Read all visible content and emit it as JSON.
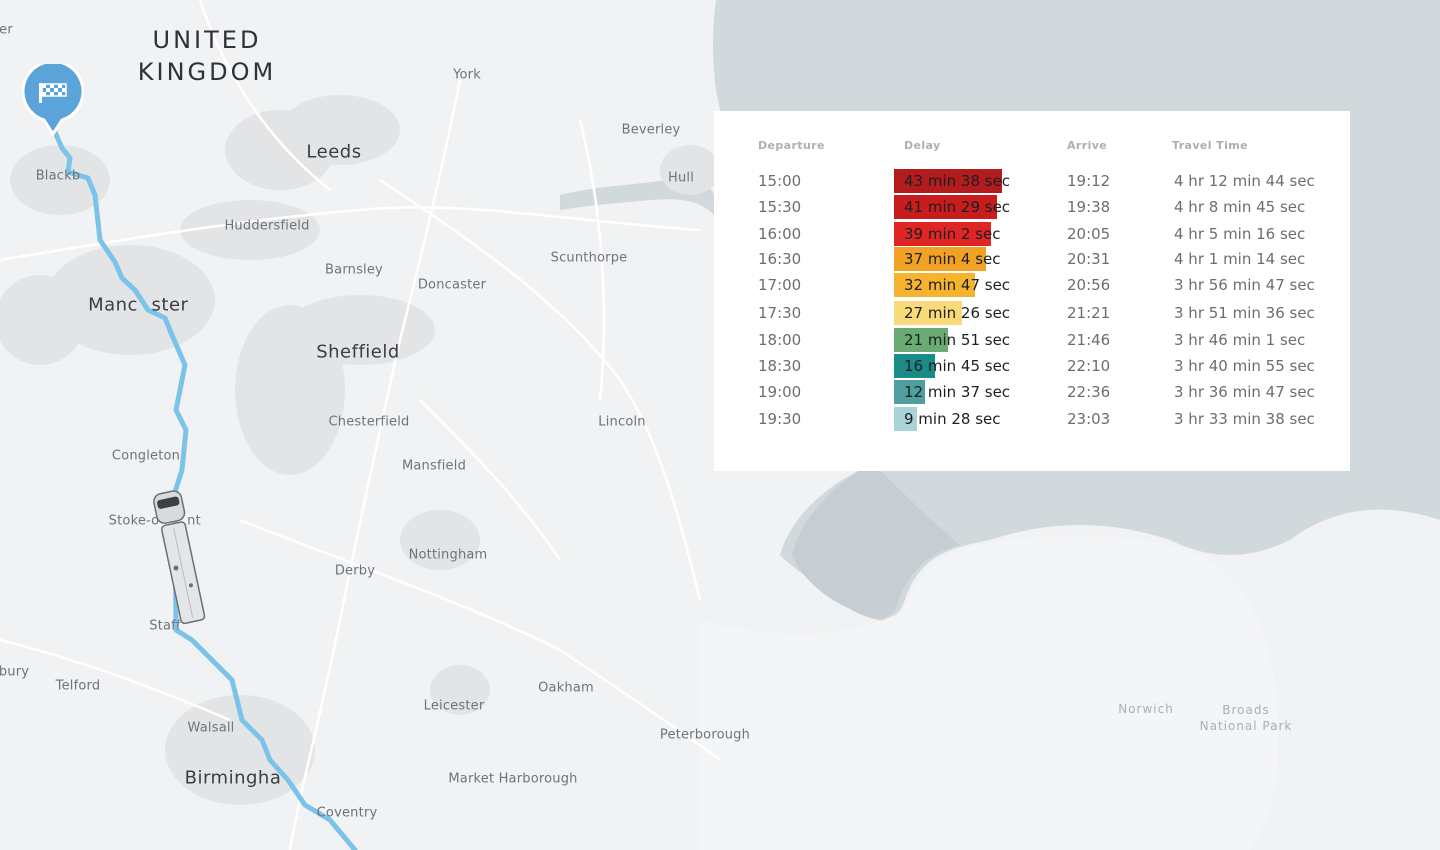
{
  "map": {
    "country_line1": "UNITED",
    "country_line2": "KINGDOM",
    "places": {
      "york": "York",
      "leeds": "Leeds",
      "beverley": "Beverley",
      "hull": "Hull",
      "blackburn_partial": "Blackb",
      "huddersfield": "Huddersfield",
      "barnsley": "Barnsley",
      "doncaster": "Doncaster",
      "scunthorpe": "Scunthorpe",
      "manchester_left": "Manc",
      "manchester_right": "ster",
      "sheffield": "Sheffield",
      "chesterfield": "Chesterfield",
      "lincoln": "Lincoln",
      "congleton": "Congleton",
      "mansfield": "Mansfield",
      "stoke_left": "Stoke-o",
      "stoke_right": "nt",
      "nottingham": "Nottingham",
      "derby": "Derby",
      "stafford_partial": "Staff",
      "bury_partial": "bury",
      "telford": "Telford",
      "oakham": "Oakham",
      "leicester": "Leicester",
      "walsall": "Walsall",
      "peterborough": "Peterborough",
      "birmingham": "Birmingha",
      "market_harborough": "Market Harborough",
      "coventry": "Coventry",
      "norwich": "Norwich",
      "broads_line1": "Broads",
      "broads_line2": "National Park",
      "edge_partial": "er"
    },
    "route_color": "#7cc3ea",
    "destination_icon": "checkered-flag-icon",
    "vehicle_icon": "truck-icon"
  },
  "table": {
    "headers": {
      "departure": "Departure",
      "delay": "Delay",
      "arrive": "Arrive",
      "travel_time": "Travel Time"
    },
    "rows": [
      {
        "departure": "15:00",
        "delay": "43 min 38 sec",
        "delay_minutes": 43.63,
        "color": "#b31c1c",
        "arrive": "19:12",
        "travel": "4 hr 12 min 44 sec"
      },
      {
        "departure": "15:30",
        "delay": "41 min 29 sec",
        "delay_minutes": 41.48,
        "color": "#c91d1d",
        "arrive": "19:38",
        "travel": "4 hr 8 min 45 sec"
      },
      {
        "departure": "16:00",
        "delay": "39 min 2 sec",
        "delay_minutes": 39.03,
        "color": "#e02525",
        "arrive": "20:05",
        "travel": "4 hr 5 min 16 sec"
      },
      {
        "departure": "16:30",
        "delay": "37 min 4 sec",
        "delay_minutes": 37.07,
        "color": "#f1a224",
        "arrive": "20:31",
        "travel": "4 hr 1 min 14 sec"
      },
      {
        "departure": "17:00",
        "delay": "32 min 47 sec",
        "delay_minutes": 32.78,
        "color": "#f6b32e",
        "arrive": "20:56",
        "travel": "3 hr 56 min 47 sec"
      },
      {
        "departure": "17:30",
        "delay": "27 min 26 sec",
        "delay_minutes": 27.43,
        "color": "#f9da78",
        "arrive": "21:21",
        "travel": "3 hr 51 min 36 sec"
      },
      {
        "departure": "18:00",
        "delay": "21 min 51 sec",
        "delay_minutes": 21.85,
        "color": "#69ab72",
        "arrive": "21:46",
        "travel": "3 hr 46 min 1 sec"
      },
      {
        "departure": "18:30",
        "delay": "16 min 45 sec",
        "delay_minutes": 16.75,
        "color": "#1a8b87",
        "arrive": "22:10",
        "travel": "3 hr 40 min 55 sec"
      },
      {
        "departure": "19:00",
        "delay": "12 min 37 sec",
        "delay_minutes": 12.62,
        "color": "#4f9ea0",
        "arrive": "22:36",
        "travel": "3 hr 36 min 47 sec"
      },
      {
        "departure": "19:30",
        "delay": "9 min 28 sec",
        "delay_minutes": 9.47,
        "color": "#a9d3d6",
        "arrive": "23:03",
        "travel": "3 hr 33 min 38 sec"
      }
    ]
  }
}
